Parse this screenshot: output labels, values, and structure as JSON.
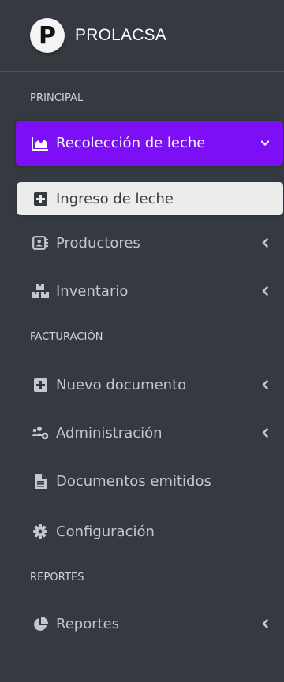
{
  "brand": {
    "logo_letter": "P",
    "name": "PROLACSA"
  },
  "sections": {
    "principal": "PRINCIPAL",
    "facturacion": "FACTURACIÓN",
    "reportes": "REPORTES"
  },
  "nav": {
    "recoleccion": {
      "label": "Recolección de leche",
      "icon": "area-chart-icon",
      "expanded": true
    },
    "ingreso": {
      "label": "Ingreso de leche",
      "icon": "plus-square-icon"
    },
    "productores": {
      "label": "Productores",
      "icon": "id-card-icon"
    },
    "inventario": {
      "label": "Inventario",
      "icon": "boxes-icon"
    },
    "nuevo_documento": {
      "label": "Nuevo documento",
      "icon": "plus-square-icon"
    },
    "administracion": {
      "label": "Administración",
      "icon": "users-cog-icon"
    },
    "documentos_emitidos": {
      "label": "Documentos emitidos",
      "icon": "file-icon"
    },
    "configuracion": {
      "label": "Configuración",
      "icon": "gear-icon"
    },
    "reportes": {
      "label": "Reportes",
      "icon": "pie-chart-icon"
    }
  },
  "colors": {
    "sidebar_bg": "#343a40",
    "active_bg": "#7c0ff5",
    "sub_active_bg": "#ececec",
    "text": "#c2c7d0"
  }
}
